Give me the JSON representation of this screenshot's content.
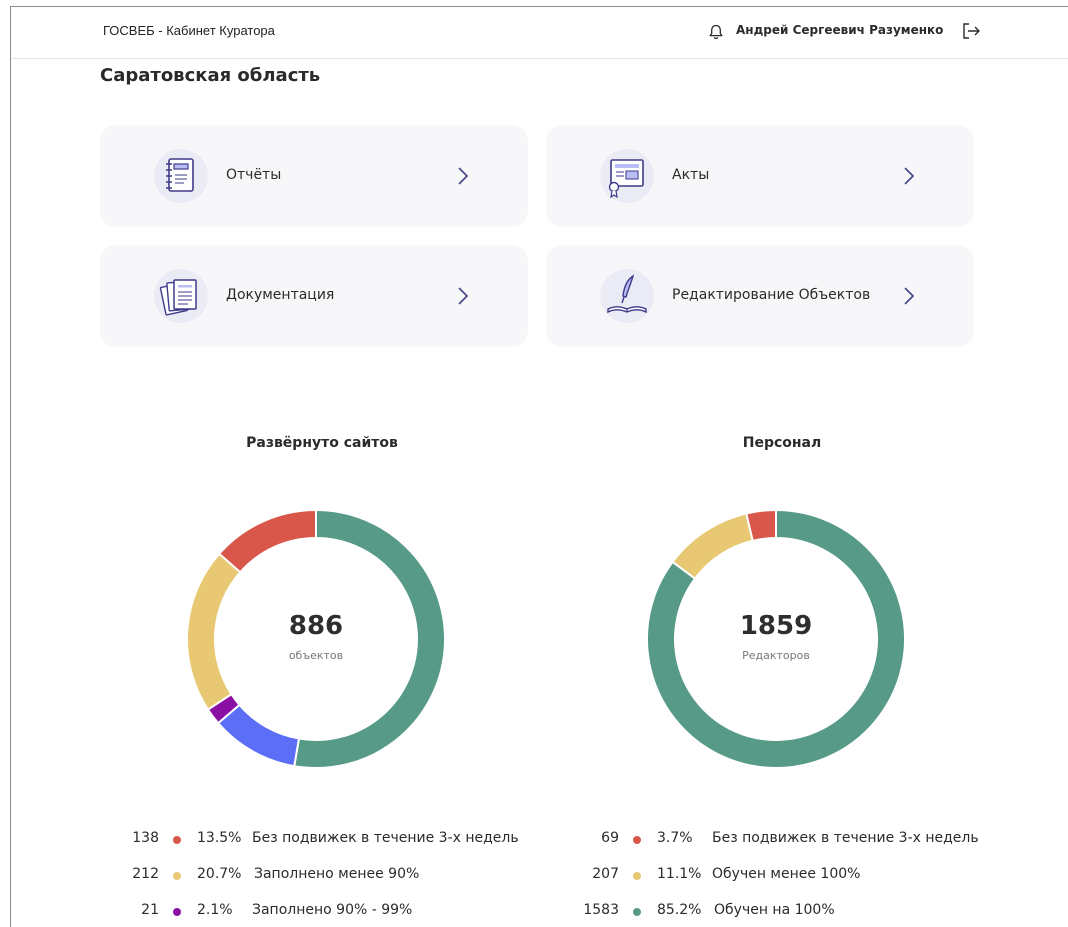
{
  "header": {
    "app_title": "ГОСВЕБ - Кабинет Куратора",
    "user_name": "Андрей Сергеевич Разуменко"
  },
  "region_title": "Саратовская область",
  "cards": [
    {
      "label": "Отчёты",
      "icon": "notebook-icon"
    },
    {
      "label": "Акты",
      "icon": "certificate-icon"
    },
    {
      "label": "Документация",
      "icon": "documents-icon"
    },
    {
      "label": "Редактирование Объектов",
      "icon": "quill-book-icon"
    }
  ],
  "colors": {
    "red": "#d9574a",
    "yellow": "#e8c872",
    "purple": "#8b0fa5",
    "blue": "#5b6ef5",
    "green": "#569a87"
  },
  "chart_data": [
    {
      "type": "pie",
      "title": "Развёрнуто сайтов",
      "center_value": "886",
      "center_label": "объектов",
      "slices": [
        {
          "label": "Без подвижек в течение 3-х недель",
          "count": 138,
          "percent": 13.5,
          "pct_text": "13.5%",
          "color": "#d9574a"
        },
        {
          "label": "Заполнено менее 90%",
          "count": 212,
          "percent": 20.7,
          "pct_text": "20.7%",
          "color": "#e8c872"
        },
        {
          "label": "Заполнено 90% - 99%",
          "count": 21,
          "percent": 2.1,
          "pct_text": "2.1%",
          "color": "#8b0fa5"
        },
        {
          "label": "",
          "count": null,
          "percent": 11.0,
          "pct_text": "",
          "color": "#5b6ef5"
        },
        {
          "label": "",
          "count": null,
          "percent": 52.7,
          "pct_text": "",
          "color": "#569a87"
        }
      ]
    },
    {
      "type": "pie",
      "title": "Персонал",
      "center_value": "1859",
      "center_label": "Редакторов",
      "slices": [
        {
          "label": "Без подвижек в течение 3-х недель",
          "count": 69,
          "percent": 3.7,
          "pct_text": "3.7%",
          "color": "#d9574a"
        },
        {
          "label": "Обучен менее 100%",
          "count": 207,
          "percent": 11.1,
          "pct_text": "11.1%",
          "color": "#e8c872"
        },
        {
          "label": "Обучен на 100%",
          "count": 1583,
          "percent": 85.2,
          "pct_text": "85.2%",
          "color": "#569a87"
        }
      ]
    }
  ]
}
